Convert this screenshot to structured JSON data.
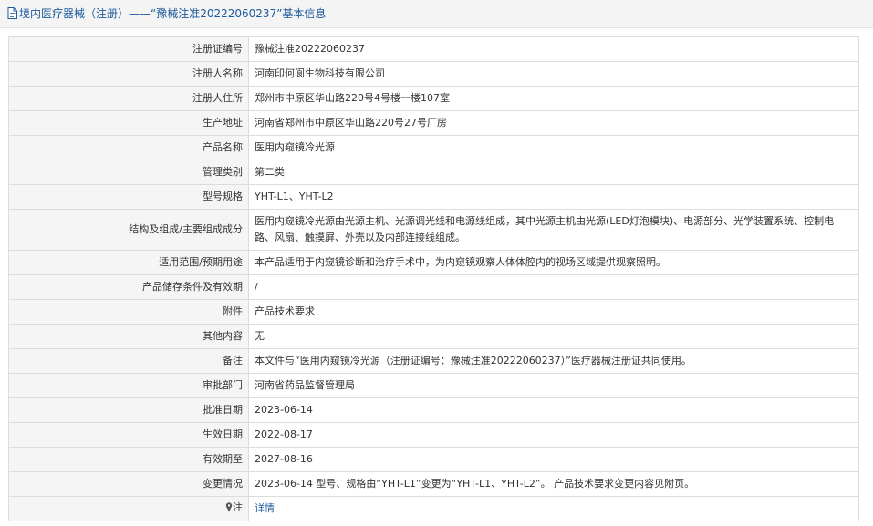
{
  "header": {
    "title": "境内医疗器械（注册）——“豫械注准20222060237”基本信息"
  },
  "rows": [
    {
      "label": "注册证编号",
      "value": "豫械注准20222060237"
    },
    {
      "label": "注册人名称",
      "value": "河南印何阆生物科技有限公司"
    },
    {
      "label": "注册人住所",
      "value": "郑州市中原区华山路220号4号楼一楼107室"
    },
    {
      "label": "生产地址",
      "value": "河南省郑州市中原区华山路220号27号厂房"
    },
    {
      "label": "产品名称",
      "value": "医用内窥镜冷光源"
    },
    {
      "label": "管理类别",
      "value": "第二类"
    },
    {
      "label": "型号规格",
      "value": "YHT-L1、YHT-L2"
    },
    {
      "label": "结构及组成/主要组成成分",
      "value": "医用内窥镜冷光源由光源主机、光源调光线和电源线组成，其中光源主机由光源(LED灯泡模块)、电源部分、光学装置系统、控制电路、风扇、触摸屏、外壳以及内部连接线组成。"
    },
    {
      "label": "适用范围/预期用途",
      "value": "本产品适用于内窥镜诊断和治疗手术中，为内窥镜观察人体体腔内的视场区域提供观察照明。"
    },
    {
      "label": "产品储存条件及有效期",
      "value": "/"
    },
    {
      "label": "附件",
      "value": "产品技术要求"
    },
    {
      "label": "其他内容",
      "value": "无"
    },
    {
      "label": "备注",
      "value": "本文件与“医用内窥镜冷光源（注册证编号：豫械注准20222060237）”医疗器械注册证共同使用。"
    },
    {
      "label": "审批部门",
      "value": "河南省药品监督管理局"
    },
    {
      "label": "批准日期",
      "value": "2023-06-14"
    },
    {
      "label": "生效日期",
      "value": "2022-08-17"
    },
    {
      "label": "有效期至",
      "value": "2027-08-16"
    },
    {
      "label": "变更情况",
      "value": "2023-06-14 型号、规格由“YHT-L1”变更为“YHT-L1、YHT-L2”。 产品技术要求变更内容见附页。"
    }
  ],
  "note_row": {
    "label": "注",
    "link": "详情",
    "icon": "pin-icon"
  },
  "colors": {
    "accent": "#1c5a9c",
    "label_bg": "#f5f5f5",
    "border": "#dcdcdc"
  }
}
